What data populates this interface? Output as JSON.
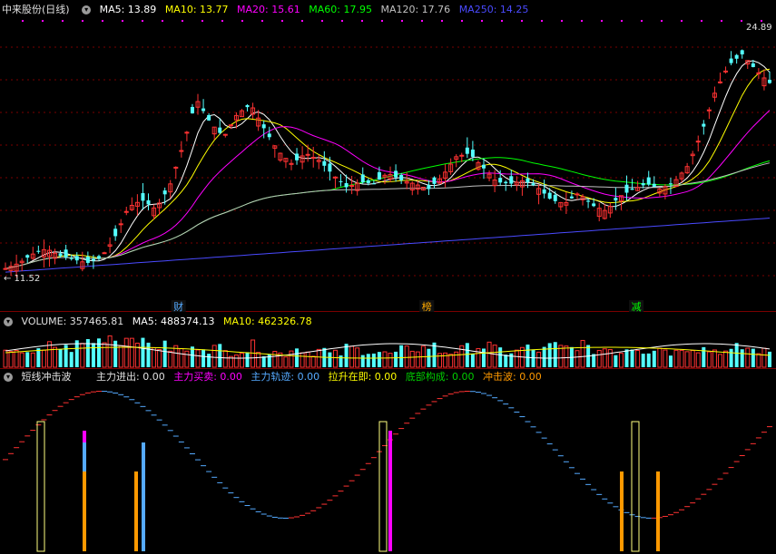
{
  "colors": {
    "up": "#ff3232",
    "down": "#54ffff",
    "ma5": "#ffffff",
    "ma10": "#ffff00",
    "ma20": "#ff00ff",
    "ma60": "#00ff00",
    "ma120": "#c0c0c0",
    "ma250": "#4a4aff",
    "grid": "#7a0000",
    "dots": "#ff00ff",
    "orange": "#ff9900",
    "magenta": "#ff00ff",
    "skyblue": "#55aaff",
    "yellow": "#ffff80",
    "green": "#00c000"
  },
  "main": {
    "stock_name": "中来股份(日线)",
    "ma": [
      {
        "label": "MA5: 13.89",
        "color": "#ffffff"
      },
      {
        "label": "MA10: 13.77",
        "color": "#ffff00"
      },
      {
        "label": "MA20: 15.61",
        "color": "#ff00ff"
      },
      {
        "label": "MA60: 17.95",
        "color": "#00ff00"
      },
      {
        "label": "MA120: 17.76",
        "color": "#c0c0c0"
      },
      {
        "label": "MA250: 14.25",
        "color": "#4a4aff"
      }
    ],
    "high_label": "24.89",
    "low_label": "11.52",
    "markers": [
      {
        "text": "财",
        "color": "#54aaff"
      },
      {
        "text": "榜",
        "color": "#ffaa00"
      },
      {
        "text": "减",
        "color": "#00ff00"
      }
    ]
  },
  "volume": {
    "title": "VOLUME: 357465.81",
    "ma5": "MA5: 488374.13",
    "ma10": "MA10: 462326.78"
  },
  "indicator": {
    "title": "短线冲击波",
    "items": [
      {
        "label": "主力进出: 0.00",
        "color": "#e0e0e0"
      },
      {
        "label": "主力买卖: 0.00",
        "color": "#ff00ff"
      },
      {
        "label": "主力轨迹: 0.00",
        "color": "#55aaff"
      },
      {
        "label": "拉升在即: 0.00",
        "color": "#ffff00"
      },
      {
        "label": "底部构成: 0.00",
        "color": "#00c000"
      },
      {
        "label": "冲击波: 0.00",
        "color": "#ff9900"
      }
    ]
  },
  "chart_data": {
    "type": "candlestick",
    "price_range": [
      11.52,
      24.89
    ],
    "close_path": [
      12.1,
      12.4,
      12.9,
      13.2,
      12.8,
      12.6,
      12.4,
      12.7,
      13.8,
      15.5,
      15.9,
      15.4,
      16.6,
      18.9,
      21.5,
      20.2,
      19.4,
      20.7,
      21.2,
      19.8,
      18.6,
      17.9,
      18.5,
      18.1,
      17.3,
      16.6,
      16.9,
      16.8,
      17.4,
      17.0,
      16.8,
      16.5,
      17.2,
      18.3,
      18.5,
      17.7,
      16.9,
      16.8,
      17.0,
      16.6,
      15.9,
      15.7,
      16.3,
      15.6,
      15.3,
      16.1,
      16.5,
      16.8,
      16.5,
      16.9,
      17.8,
      19.6,
      21.9,
      23.4,
      24.0,
      23.1,
      22.4
    ],
    "volume_levels": [
      0.35,
      0.45,
      0.4,
      0.55,
      0.5,
      0.6,
      0.7,
      0.85,
      0.75,
      0.9,
      0.6,
      0.55,
      0.5,
      0.45,
      0.6,
      0.5,
      0.4,
      0.45,
      0.55,
      0.4,
      0.35,
      0.5,
      0.4,
      0.45,
      0.35,
      0.5,
      0.45,
      0.4,
      0.35,
      0.45,
      0.5,
      0.55,
      0.4,
      0.45,
      0.5,
      0.55,
      0.45,
      0.4,
      0.5,
      0.45,
      0.55,
      0.5,
      0.6,
      0.45,
      0.5,
      0.4,
      0.55,
      0.45,
      0.5,
      0.4,
      0.55,
      0.5,
      0.45,
      0.4,
      0.5,
      0.45,
      0.4
    ],
    "markers_at": [
      0.23,
      0.55,
      0.82
    ]
  }
}
